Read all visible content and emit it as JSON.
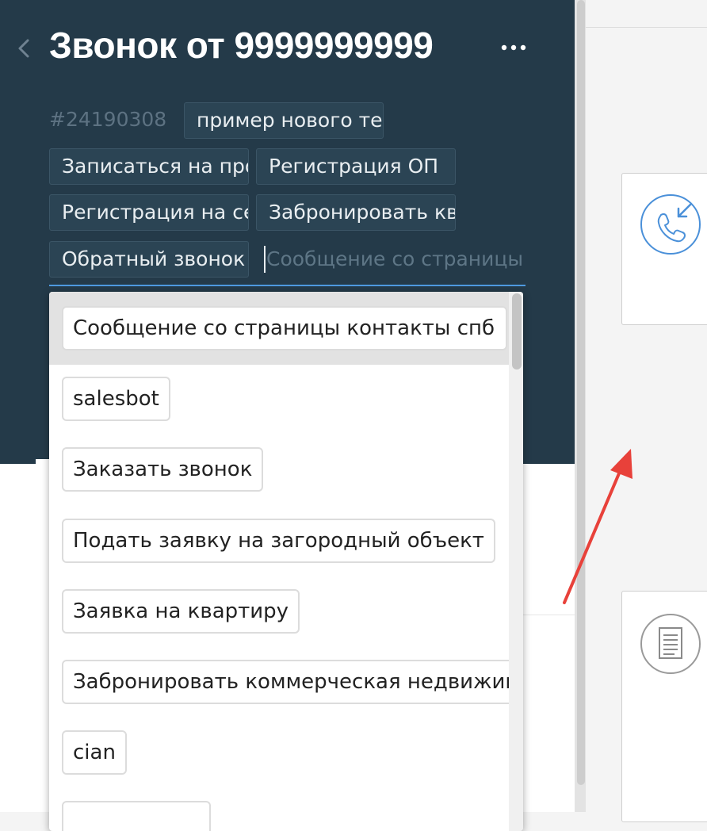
{
  "header": {
    "title": "Звонок от 9999999999",
    "deal_id": "#24190308"
  },
  "tags": [
    "пример нового тега",
    "Записаться на просмотр",
    "Регистрация ОП",
    "Регистрация на семинар",
    "Забронировать квартиру",
    "Обратный звонок"
  ],
  "tag_input": {
    "placeholder": "Сообщение со страницы контакты спб"
  },
  "dropdown": {
    "items": [
      "Сообщение со страницы контакты спб",
      "salesbot",
      "Заказать звонок",
      "Подать заявку на загородный объект",
      "Заявка на квартиру",
      "Забронировать коммерческая недвижимость",
      "cian",
      ""
    ]
  },
  "colors": {
    "header_bg": "#243a49",
    "tag_bg": "#2b4454",
    "accent_blue": "#4f9ae0",
    "annotation_arrow": "#e8413a"
  },
  "icons": [
    "back-chevron-icon",
    "more-dots-icon",
    "incoming-call-icon",
    "document-icon",
    "annotation-arrow"
  ]
}
